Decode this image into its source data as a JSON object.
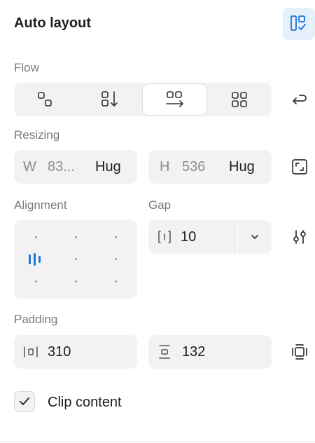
{
  "panel": {
    "title": "Auto layout",
    "toggle_icon": "auto-layout-toggle-icon",
    "accent_color": "#1e73d8",
    "active_bg": "#e5f0fb"
  },
  "flow": {
    "label": "Flow",
    "options": [
      {
        "name": "vertical-layout-icon",
        "active": false
      },
      {
        "name": "vertical-arrow-icon",
        "active": false
      },
      {
        "name": "horizontal-arrow-icon",
        "active": true
      },
      {
        "name": "grid-layout-icon",
        "active": false
      }
    ],
    "wrap_icon": "wrap-icon"
  },
  "resizing": {
    "label": "Resizing",
    "width": {
      "prefix": "W",
      "value": "83...",
      "mode": "Hug"
    },
    "height": {
      "prefix": "H",
      "value": "536",
      "mode": "Hug"
    },
    "expand_icon": "resize-corners-icon"
  },
  "alignment": {
    "label": "Alignment",
    "selected": "middle-left"
  },
  "gap": {
    "label": "Gap",
    "value": "10",
    "icon": "gap-icon",
    "dropdown_icon": "chevron-down-icon",
    "settings_icon": "sliders-icon"
  },
  "padding": {
    "label": "Padding",
    "horizontal": "310",
    "vertical": "132",
    "individual_icon": "padding-individual-icon"
  },
  "clip": {
    "label": "Clip content",
    "checked": true
  }
}
